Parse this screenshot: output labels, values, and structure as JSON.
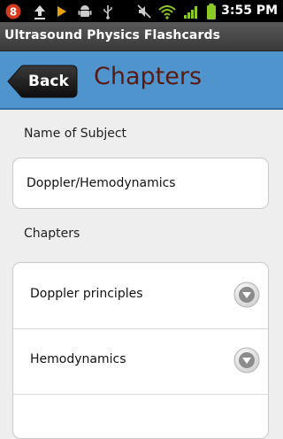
{
  "status_bar": {
    "notification_count": "8",
    "time": "3:55 PM",
    "icons": [
      "notification-badge-icon",
      "upload-icon",
      "play-store-icon",
      "android-debug-icon",
      "usb-icon",
      "mute-icon",
      "wifi-icon",
      "signal-icon",
      "battery-icon"
    ]
  },
  "app": {
    "title": "Ultrasound Physics Flashcards"
  },
  "nav": {
    "back_label": "Back",
    "title": "Chapters"
  },
  "subject": {
    "label": "Name of Subject",
    "value": "Doppler/Hemodynamics"
  },
  "chapters": {
    "label": "Chapters",
    "items": [
      {
        "label": "Doppler principles",
        "icon": "chevron-down-icon"
      },
      {
        "label": "Hemodynamics",
        "icon": "chevron-down-icon"
      }
    ]
  },
  "colors": {
    "nav_bar": "#4f94cd",
    "nav_title": "#5a1a10",
    "background": "#eeeeee"
  }
}
